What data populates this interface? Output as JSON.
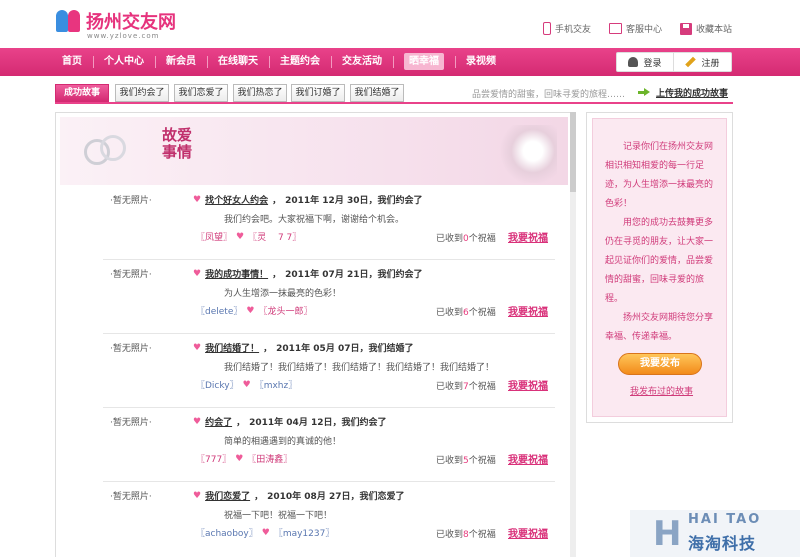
{
  "header": {
    "logo_text": "扬州交友网",
    "logo_url": "www.yzlove.com",
    "links": [
      {
        "label": "手机交友",
        "icon": "phone-icon"
      },
      {
        "label": "客服中心",
        "icon": "monitor-icon"
      },
      {
        "label": "收藏本站",
        "icon": "bookmark-icon"
      }
    ]
  },
  "nav": {
    "items": [
      "首页",
      "个人中心",
      "新会员",
      "在线聊天",
      "主题约会",
      "交友活动",
      "晒幸福",
      "录视频"
    ],
    "active_index": 6,
    "login_label": "登录",
    "register_label": "注册"
  },
  "subnav": {
    "tabs": [
      "成功故事",
      "我们约会了",
      "我们恋爱了",
      "我们热恋了",
      "我们订婚了",
      "我们结婚了"
    ],
    "active_index": 0,
    "note": "品尝爱情的甜蜜，回味寻爱的旅程……",
    "upload_label": "上传我的成功故事"
  },
  "banner": {
    "title": "故爱事情"
  },
  "stories": [
    {
      "photo": "·暂无照片·",
      "title": "找个好女人约会",
      "sep": "，",
      "date_status": "2011年 12月 30日，我们约会了",
      "excerpt": "我们约会吧。大家祝福下啊，谢谢给个机会。",
      "member1": "〖凤望〗",
      "member2": "〖灵　 7 7〗",
      "count_pre": "已收到",
      "count": "0",
      "count_post": "个祝福",
      "bless": "我要祝福"
    },
    {
      "photo": "·暂无照片·",
      "title": "我的成功事情！",
      "sep": "，",
      "date_status": "2011年 07月 21日，我们约会了",
      "excerpt": "为人生增添一抹最亮的色彩！",
      "member1": "〖delete〗",
      "member2": "〖龙头一郎〗",
      "count_pre": "已收到",
      "count": "6",
      "count_post": "个祝福",
      "bless": "我要祝福"
    },
    {
      "photo": "·暂无照片·",
      "title": "我们结婚了！",
      "sep": "，",
      "date_status": "2011年 05月 07日，我们结婚了",
      "excerpt": "我们结婚了！我们结婚了！我们结婚了！我们结婚了！我们结婚了！",
      "member1": "〖Dicky〗",
      "member2": "〖mxhz〗",
      "count_pre": "已收到",
      "count": "7",
      "count_post": "个祝福",
      "bless": "我要祝福"
    },
    {
      "photo": "·暂无照片·",
      "title": "约会了",
      "sep": "，",
      "date_status": "2011年 04月 12日，我们约会了",
      "excerpt": "简单的相遇遇到的真诚的他！",
      "member1": "〖777〗",
      "member2": "〖田涛鑫〗",
      "count_pre": "已收到",
      "count": "5",
      "count_post": "个祝福",
      "bless": "我要祝福"
    },
    {
      "photo": "·暂无照片·",
      "title": "我们恋爱了",
      "sep": "，",
      "date_status": "2010年 08月 27日，我们恋爱了",
      "excerpt": "祝福一下吧！祝福一下吧！",
      "member1": "〖achaoboy〗",
      "member2": "〖may1237〗",
      "count_pre": "已收到",
      "count": "8",
      "count_post": "个祝福",
      "bless": "我要祝福"
    }
  ],
  "sidebar": {
    "paragraphs": [
      "记录你们在扬州交友网相识相知相爱的每一行足迹，为人生增添一抹最亮的色彩！",
      "用您的成功去鼓舞更多仍在寻觅的朋友，让大家一起见证你们的爱情，品尝爱情的甜蜜，回味寻爱的旅程。",
      "扬州交友网期待您分享幸福、传递幸福。"
    ],
    "publish_label": "我要发布",
    "my_stories_label": "我发布过的故事"
  },
  "watermark": {
    "letter": "H",
    "en": "HAI TAO",
    "cn": "海淘科技"
  }
}
